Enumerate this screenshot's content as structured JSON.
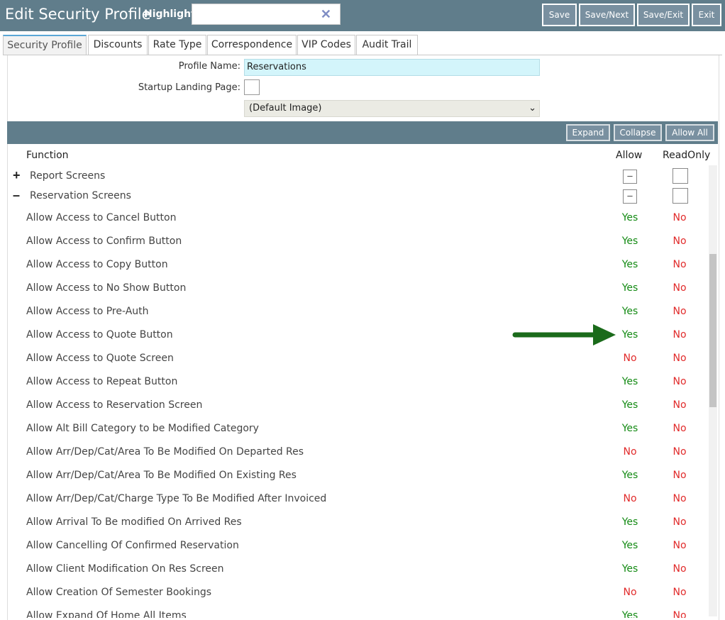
{
  "header": {
    "title": "Edit Security Profile",
    "highlight_label": "Highlight:",
    "highlight_value": "",
    "buttons": [
      "Save",
      "Save/Next",
      "Save/Exit",
      "Exit"
    ]
  },
  "tabs": [
    {
      "label": "Security Profile",
      "active": true
    },
    {
      "label": "Discounts"
    },
    {
      "label": "Rate Type"
    },
    {
      "label": "Correspondence"
    },
    {
      "label": "VIP Codes"
    },
    {
      "label": "Audit Trail"
    }
  ],
  "form": {
    "profile_name_label": "Profile Name:",
    "profile_name": "Reservations",
    "landing_label": "Startup Landing Page:",
    "image_select": "(Default Image)"
  },
  "toolbar": {
    "expand": "Expand",
    "collapse": "Collapse",
    "allow_all": "Allow All"
  },
  "grid": {
    "headers": {
      "function": "Function",
      "allow": "Allow",
      "readonly": "ReadOnly"
    },
    "groups": [
      {
        "sign": "+",
        "label": "Report Screens",
        "allow_mark": "–"
      },
      {
        "sign": "–",
        "label": "Reservation Screens",
        "allow_mark": "–"
      }
    ],
    "rows": [
      {
        "label": "Allow Access to Cancel Button",
        "allow": "Yes",
        "readonly": "No"
      },
      {
        "label": "Allow Access to Confirm Button",
        "allow": "Yes",
        "readonly": "No"
      },
      {
        "label": "Allow Access to Copy Button",
        "allow": "Yes",
        "readonly": "No"
      },
      {
        "label": "Allow Access to No Show Button",
        "allow": "Yes",
        "readonly": "No"
      },
      {
        "label": "Allow Access to Pre-Auth",
        "allow": "Yes",
        "readonly": "No"
      },
      {
        "label": "Allow Access to Quote Button",
        "allow": "Yes",
        "readonly": "No"
      },
      {
        "label": "Allow Access to Quote Screen",
        "allow": "No",
        "readonly": "No"
      },
      {
        "label": "Allow Access to Repeat Button",
        "allow": "Yes",
        "readonly": "No"
      },
      {
        "label": "Allow Access to Reservation Screen",
        "allow": "Yes",
        "readonly": "No"
      },
      {
        "label": "Allow Alt Bill Category to be Modified Category",
        "allow": "Yes",
        "readonly": "No"
      },
      {
        "label": "Allow Arr/Dep/Cat/Area To Be Modified On Departed Res",
        "allow": "No",
        "readonly": "No"
      },
      {
        "label": "Allow Arr/Dep/Cat/Area To Be Modified On Existing Res",
        "allow": "Yes",
        "readonly": "No"
      },
      {
        "label": "Allow Arr/Dep/Cat/Charge Type To Be Modified After Invoiced",
        "allow": "No",
        "readonly": "No"
      },
      {
        "label": "Allow Arrival To Be modified On Arrived Res",
        "allow": "Yes",
        "readonly": "No"
      },
      {
        "label": "Allow Cancelling Of Confirmed Reservation",
        "allow": "Yes",
        "readonly": "No"
      },
      {
        "label": "Allow Client Modification On Res Screen",
        "allow": "Yes",
        "readonly": "No"
      },
      {
        "label": "Allow Creation Of Semester Bookings",
        "allow": "No",
        "readonly": "No"
      },
      {
        "label": "Allow Expand Of Home All Items",
        "allow": "Yes",
        "readonly": "No"
      }
    ]
  },
  "colors": {
    "header": "#607d8b",
    "yes": "#138a13",
    "no": "#e12a2a",
    "arrow": "#1b6b1b"
  }
}
